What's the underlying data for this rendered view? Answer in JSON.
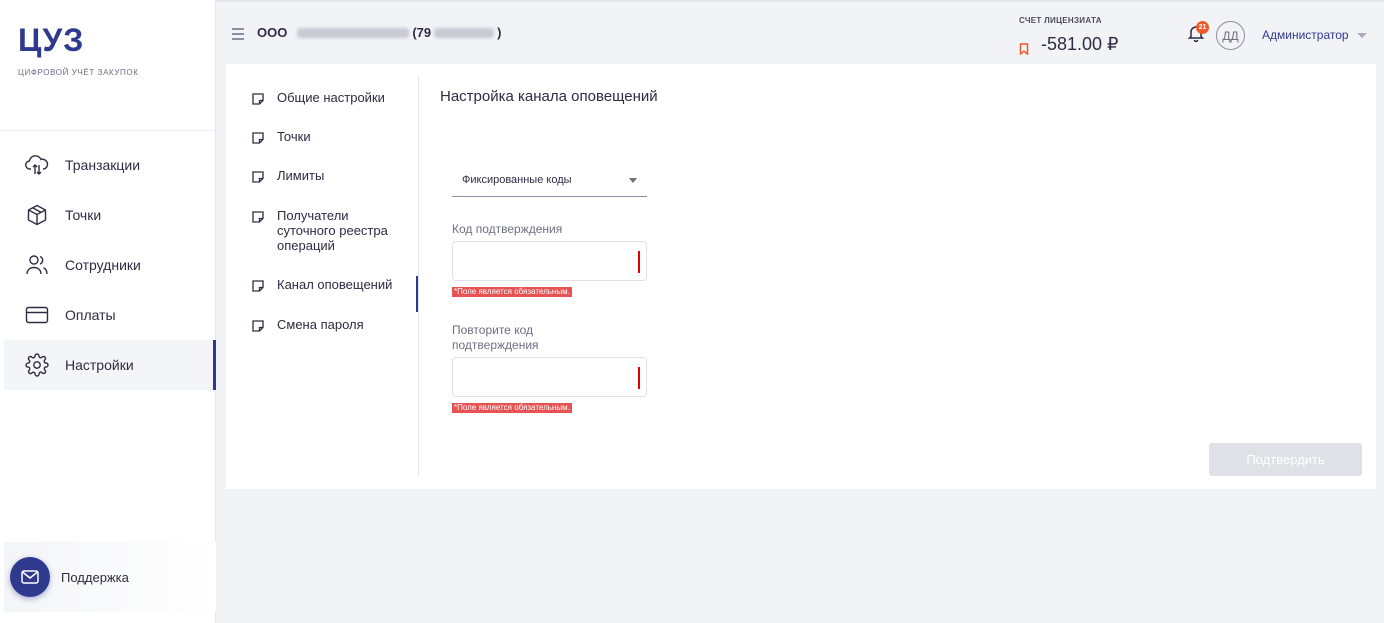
{
  "brand": {
    "logo": "ЦУЗ",
    "tagline": "ЦИФРОВОЙ УЧЁТ ЗАКУПОК"
  },
  "sidebar": {
    "items": [
      {
        "label": "Транзакции",
        "icon": "cloud-transfer-icon"
      },
      {
        "label": "Точки",
        "icon": "box-icon"
      },
      {
        "label": "Сотрудники",
        "icon": "users-icon"
      },
      {
        "label": "Оплаты",
        "icon": "card-icon"
      },
      {
        "label": "Настройки",
        "icon": "gear-icon",
        "active": true
      }
    ],
    "support_label": "Поддержка"
  },
  "header": {
    "org_prefix": "ООО",
    "org_paren_open": "(79",
    "org_paren_close": ")",
    "account_label": "СЧЕТ ЛИЦЕНЗИАТА",
    "account_value": "-581.00 ₽",
    "notifications_count": "21",
    "avatar_initials": "ДД",
    "user_name": "Администратор"
  },
  "settings_nav": {
    "items": [
      {
        "label": "Общие настройки"
      },
      {
        "label": "Точки"
      },
      {
        "label": "Лимиты"
      },
      {
        "label": "Получатели суточного реестра операций"
      },
      {
        "label": "Канал оповещений",
        "active": true
      },
      {
        "label": "Смена пароля"
      }
    ]
  },
  "panel": {
    "title": "Настройка канала оповещений",
    "channel_select_value": "Фиксированные коды",
    "code_label": "Код подтверждения",
    "code_error": "*Поле является обязательным.",
    "repeat_label": "Повторите код подтверждения",
    "repeat_error": "*Поле является обязательным.",
    "submit_label": "Подтвердить"
  },
  "colors": {
    "accent": "#2f3a8f",
    "error": "#e55353",
    "badge": "#ef5a28",
    "balance_icon": "#ef5a28"
  }
}
